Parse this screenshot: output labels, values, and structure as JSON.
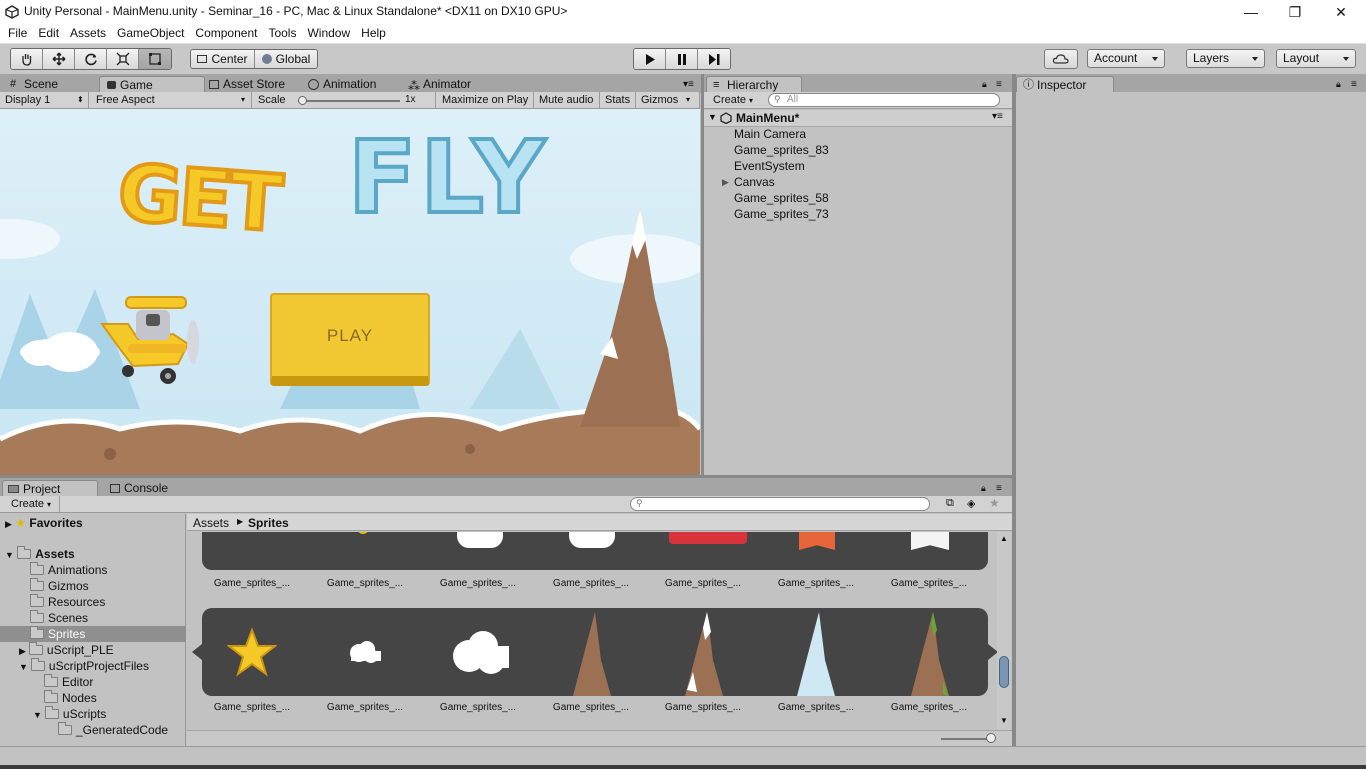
{
  "window": {
    "title": "Unity Personal - MainMenu.unity - Seminar_16 - PC, Mac & Linux Standalone* <DX11 on DX10 GPU>",
    "controls": [
      "—",
      "❐",
      "✕"
    ]
  },
  "menu": [
    "File",
    "Edit",
    "Assets",
    "GameObject",
    "Component",
    "Tools",
    "Window",
    "Help"
  ],
  "toolbar": {
    "pivot": "Center",
    "space": "Global",
    "account": "Account",
    "layers": "Layers",
    "layout": "Layout"
  },
  "scene_tabs": {
    "scene": "Scene",
    "game": "Game",
    "asset_store": "Asset Store",
    "animation": "Animation",
    "animator": "Animator"
  },
  "game_bar": {
    "display": "Display 1",
    "aspect": "Free Aspect",
    "scale_label": "Scale",
    "scale_value": "1x",
    "scale_level": 0.05,
    "maximize": "Maximize on Play",
    "mute": "Mute audio",
    "stats": "Stats",
    "gizmos": "Gizmos"
  },
  "game_view": {
    "title_word1": "GET",
    "title_word2": "FLY",
    "play_button": "PLAY"
  },
  "hierarchy": {
    "tab": "Hierarchy",
    "create": "Create",
    "search_placeholder": "All",
    "scene": "MainMenu*",
    "items": [
      "Main Camera",
      "Game_sprites_83",
      "EventSystem",
      "Canvas",
      "Game_sprites_58",
      "Game_sprites_73"
    ]
  },
  "inspector": {
    "tab": "Inspector"
  },
  "project": {
    "tab_project": "Project",
    "tab_console": "Console",
    "create": "Create",
    "favorites": "Favorites",
    "assets": "Assets",
    "folders": [
      "Animations",
      "Gizmos",
      "Resources",
      "Scenes",
      "Sprites",
      "uScript_PLE",
      "uScriptProjectFiles",
      "Editor",
      "Nodes",
      "uScripts",
      "_GeneratedCode"
    ],
    "breadcrumb_root": "Assets",
    "breadcrumb_current": "Sprites",
    "row1": [
      "Game_sprites_...",
      "Game_sprites_...",
      "Game_sprites_...",
      "Game_sprites_...",
      "Game_sprites_...",
      "Game_sprites_...",
      "Game_sprites_..."
    ],
    "row2": [
      "Game_sprites_...",
      "Game_sprites_...",
      "Game_sprites_...",
      "Game_sprites_...",
      "Game_sprites_...",
      "Game_sprites_...",
      "Game_sprites_..."
    ]
  },
  "colors": {
    "accent_yellow": "#f2c933",
    "selected_row": "#8f8f8f",
    "panel_bg": "#c2c2c2"
  }
}
